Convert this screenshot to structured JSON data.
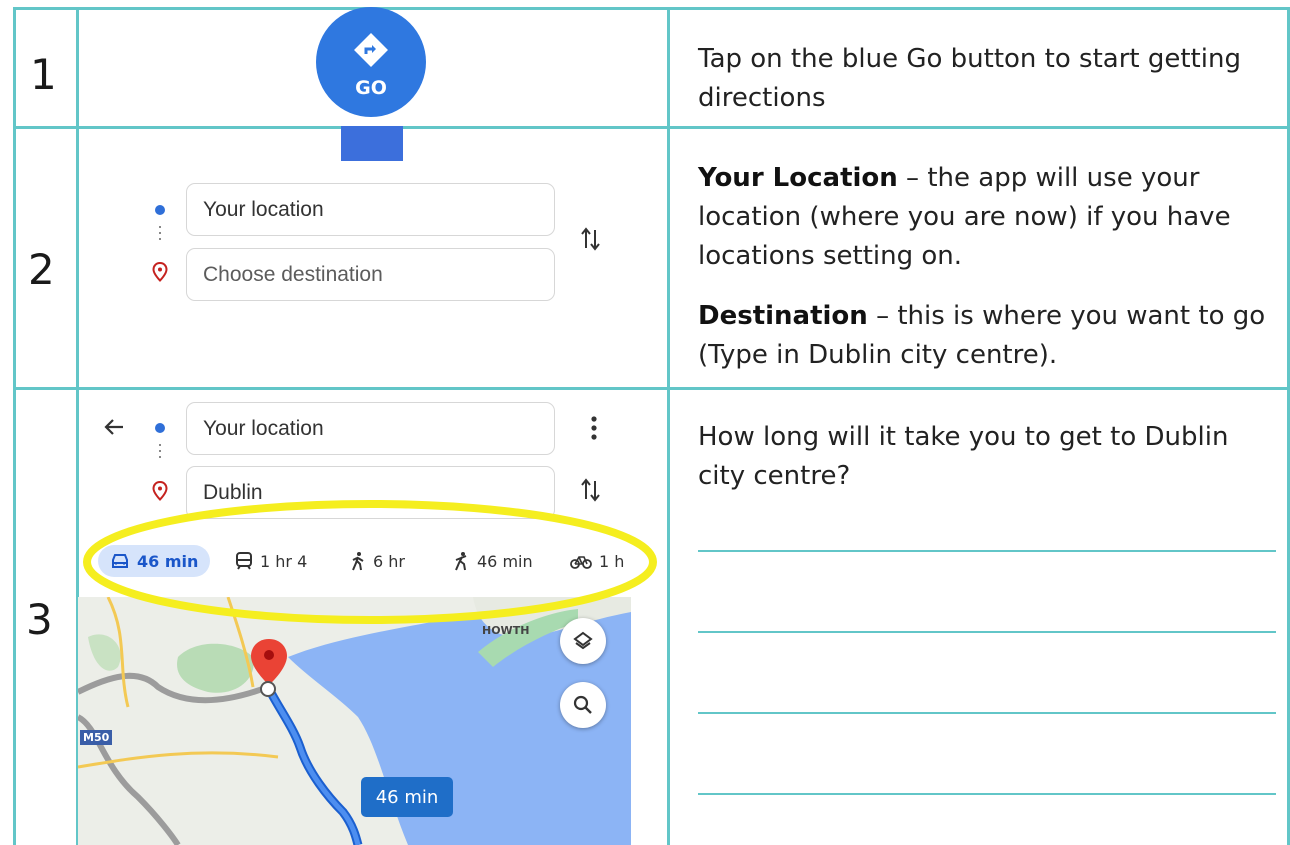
{
  "rows": [
    {
      "number": "1",
      "text": "Tap on the blue Go button to start getting directions"
    },
    {
      "number": "2",
      "para1_bold": "Your Location",
      "para1_text": " – the app will use your location (where you are now) if you have locations setting on.",
      "para2_bold": "Destination",
      "para2_text": " – this is where you want to go (Type in Dublin city centre)."
    },
    {
      "number": "3",
      "text": "How long will it take you to get to Dublin city centre?"
    }
  ],
  "go_button": {
    "label": "GO",
    "color": "#2f78e0"
  },
  "step2": {
    "origin_value": "Your location",
    "destination_placeholder": "Choose destination"
  },
  "step3": {
    "origin_value": "Your location",
    "destination_value": "Dublin",
    "modes": [
      {
        "icon": "car-icon",
        "label": "46 min"
      },
      {
        "icon": "transit-icon",
        "label": "1 hr 4"
      },
      {
        "icon": "walk-icon",
        "label": "6 hr"
      },
      {
        "icon": "ride-icon",
        "label": "46 min"
      },
      {
        "icon": "bike-icon",
        "label": "1 h"
      }
    ],
    "map": {
      "label_howth": "HOWTH",
      "label_m50": "M50",
      "route_badge": "46 min"
    },
    "highlight_color": "#f5ee1f"
  },
  "colors": {
    "table_border": "#62c6c8",
    "accent_blue": "#1a73e8",
    "pin_red": "#d93025"
  }
}
